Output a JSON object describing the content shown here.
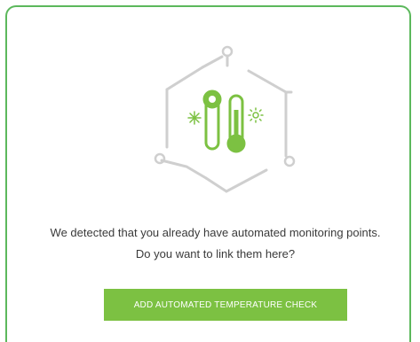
{
  "message": {
    "line1": "We detected that you already have automated monitoring points.",
    "line2": "Do you want to link them here?"
  },
  "cta": {
    "label": "ADD AUTOMATED TEMPERATURE CHECK"
  },
  "colors": {
    "accent": "#7cc142",
    "border": "#5cb85c",
    "illustration_line": "#cfcfcf",
    "text": "#3a3a3a"
  },
  "icons": [
    "hexagon-network-icon",
    "thermometer-icon",
    "snowflake-icon",
    "sun-icon"
  ]
}
